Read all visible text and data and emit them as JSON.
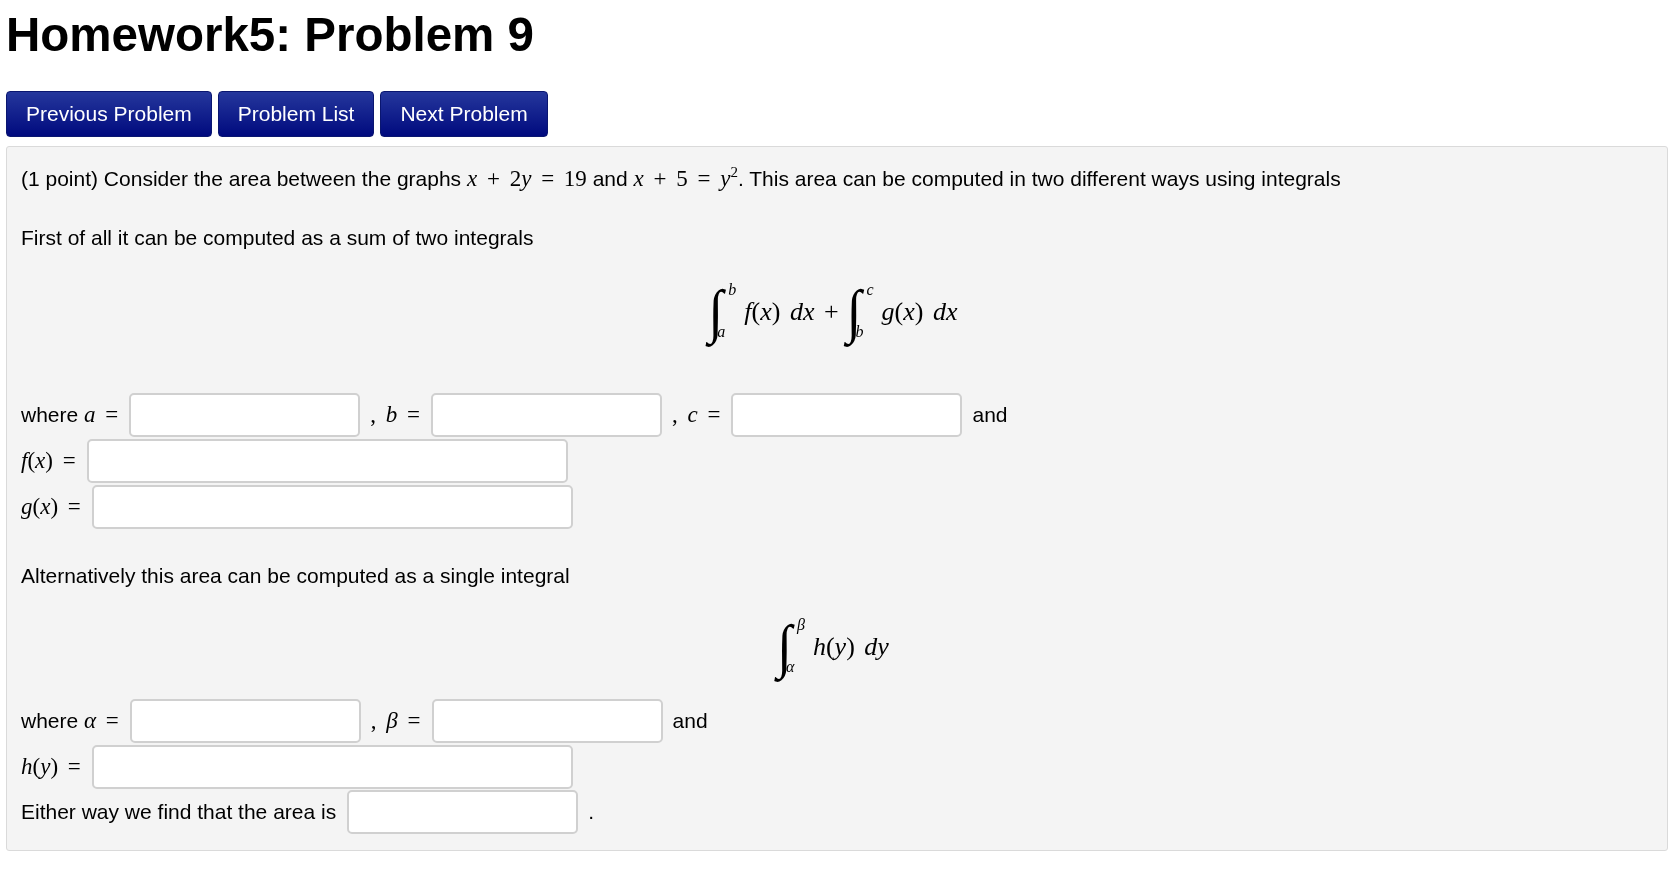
{
  "page_title": "Homework5: Problem 9",
  "nav_buttons": [
    {
      "label": "Previous Problem"
    },
    {
      "label": "Problem List"
    },
    {
      "label": "Next Problem"
    }
  ],
  "problem": {
    "blocks": [
      {
        "kind": "paragraph",
        "parts": [
          {
            "kind": "text",
            "text": "(1 point) Consider the area between the graphs "
          },
          {
            "kind": "math",
            "text": "*x* + 2"
          },
          {
            "kind": "math",
            "text": "*y* = 19"
          },
          {
            "kind": "text",
            "text": " and "
          },
          {
            "kind": "math",
            "text": "*x* + 5 = *y*$^{2}$"
          },
          {
            "kind": "text",
            "text": ". This area can be computed in two different ways using integrals"
          }
        ]
      },
      {
        "kind": "paragraph",
        "parts": [
          {
            "kind": "text",
            "text": "First of all it can be computed as a sum of two integrals"
          }
        ]
      },
      {
        "kind": "display",
        "items": [
          {
            "kind": "integral",
            "sign": "∫",
            "lower": "a",
            "upper": "b"
          },
          {
            "kind": "math",
            "text": "*f*(*x*) *dx* +"
          },
          {
            "kind": "integral",
            "sign": "∫",
            "lower": "b",
            "upper": "c"
          },
          {
            "kind": "math",
            "text": "*g*(*x*) *dx*"
          }
        ]
      },
      {
        "kind": "answer_row",
        "items": [
          {
            "kind": "label",
            "parts": [
              {
                "kind": "text",
                "text": "where "
              },
              {
                "kind": "math",
                "text": "*a* ="
              }
            ]
          },
          {
            "kind": "field",
            "wide": false
          },
          {
            "kind": "label",
            "parts": [
              {
                "kind": "math",
                "text": ", *b* ="
              }
            ]
          },
          {
            "kind": "field",
            "wide": false
          },
          {
            "kind": "label",
            "parts": [
              {
                "kind": "math",
                "text": ", *c* ="
              }
            ]
          },
          {
            "kind": "field",
            "wide": false
          },
          {
            "kind": "label",
            "parts": [
              {
                "kind": "text",
                "text": "and"
              }
            ]
          }
        ]
      },
      {
        "kind": "answer_row",
        "items": [
          {
            "kind": "label",
            "parts": [
              {
                "kind": "math",
                "text": "*f*(*x*) ="
              }
            ]
          },
          {
            "kind": "field",
            "wide": true
          }
        ]
      },
      {
        "kind": "answer_row",
        "items": [
          {
            "kind": "label",
            "parts": [
              {
                "kind": "math",
                "text": "*g*(*x*) ="
              }
            ]
          },
          {
            "kind": "field",
            "wide": true
          }
        ]
      },
      {
        "kind": "paragraph",
        "parts": [
          {
            "kind": "text",
            "text": "Alternatively this area can be computed as a single integral"
          }
        ]
      },
      {
        "kind": "display",
        "items": [
          {
            "kind": "integral",
            "sign": "∫",
            "lower": "α",
            "upper": "β"
          },
          {
            "kind": "math",
            "text": "*h*(*y*) *dy*"
          }
        ]
      },
      {
        "kind": "answer_row",
        "items": [
          {
            "kind": "label",
            "parts": [
              {
                "kind": "text",
                "text": "where "
              },
              {
                "kind": "math",
                "text": "*α* ="
              }
            ]
          },
          {
            "kind": "field",
            "wide": false
          },
          {
            "kind": "label",
            "parts": [
              {
                "kind": "math",
                "text": ", *β* ="
              }
            ]
          },
          {
            "kind": "field",
            "wide": false
          },
          {
            "kind": "label",
            "parts": [
              {
                "kind": "text",
                "text": "and"
              }
            ]
          }
        ]
      },
      {
        "kind": "answer_row",
        "items": [
          {
            "kind": "label",
            "parts": [
              {
                "kind": "math",
                "text": "*h*(*y*) ="
              }
            ]
          },
          {
            "kind": "field",
            "wide": true
          }
        ]
      },
      {
        "kind": "answer_row",
        "items": [
          {
            "kind": "label",
            "parts": [
              {
                "kind": "text",
                "text": "Either way we find that the area is"
              }
            ]
          },
          {
            "kind": "field",
            "wide": false
          },
          {
            "kind": "label",
            "parts": [
              {
                "kind": "text",
                "text": "."
              }
            ]
          }
        ]
      }
    ]
  }
}
